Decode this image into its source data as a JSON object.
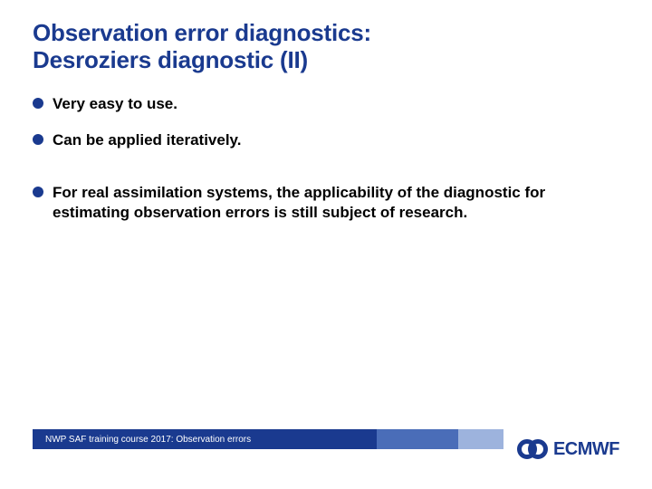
{
  "title_line1": "Observation error diagnostics:",
  "title_line2": "Desroziers diagnostic (II)",
  "bullets": [
    "Very easy to use.",
    "Can be applied iteratively.",
    "For real assimilation systems, the applicability of the diagnostic for estimating observation errors is still subject of research."
  ],
  "footer_text": "NWP SAF training course 2017: Observation errors",
  "logo_text": "ECMWF",
  "colors": {
    "brand": "#1a3a8f",
    "band_mid": "#4a6db8",
    "band_light": "#9db3dd"
  }
}
